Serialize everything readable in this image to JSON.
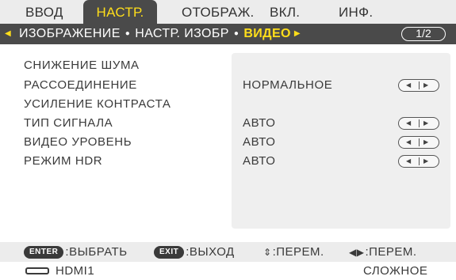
{
  "tabs": [
    {
      "label": "ВВОД",
      "active": false
    },
    {
      "label": "НАСТР.",
      "active": true
    },
    {
      "label": "ОТОБРАЖ.",
      "active": false
    },
    {
      "label": "ВКЛ.",
      "active": false
    },
    {
      "label": "ИНФ.",
      "active": false
    }
  ],
  "breadcrumb": {
    "items": [
      "ИЗОБРАЖЕНИЕ",
      "НАСТР. ИЗОБР",
      "ВИДЕО"
    ],
    "page": "1/2"
  },
  "settings": [
    {
      "label": "СНИЖЕНИЕ ШУМА",
      "value": "",
      "stepper": false
    },
    {
      "label": "РАССОЕДИНЕНИЕ",
      "value": "НОРМАЛЬНОЕ",
      "stepper": true
    },
    {
      "label": "УСИЛЕНИЕ КОНТРАСТА",
      "value": "",
      "stepper": false
    },
    {
      "label": "ТИП СИГНАЛА",
      "value": "АВТО",
      "stepper": true
    },
    {
      "label": "ВИДЕО УРОВЕНЬ",
      "value": "АВТО",
      "stepper": true
    },
    {
      "label": "РЕЖИМ HDR",
      "value": "АВТО",
      "stepper": true
    }
  ],
  "help": {
    "enter_key": "ENTER",
    "enter_label": ":ВЫБРАТЬ",
    "exit_key": "EXIT",
    "exit_label": ":ВЫХОД",
    "updown_label": ":ПЕРЕМ.",
    "leftright_label": ":ПЕРЕМ."
  },
  "status": {
    "source": "HDMI1",
    "mode": "СЛОЖНОЕ"
  },
  "colors": {
    "accent": "#ffde1a",
    "bar_dark": "#4a4a4a",
    "bar_light": "#ececec",
    "panel": "#efefef"
  },
  "icons": {
    "updown": "updown-arrows-icon",
    "leftright": "leftright-arrows-icon",
    "hdmi": "hdmi-port-icon"
  }
}
